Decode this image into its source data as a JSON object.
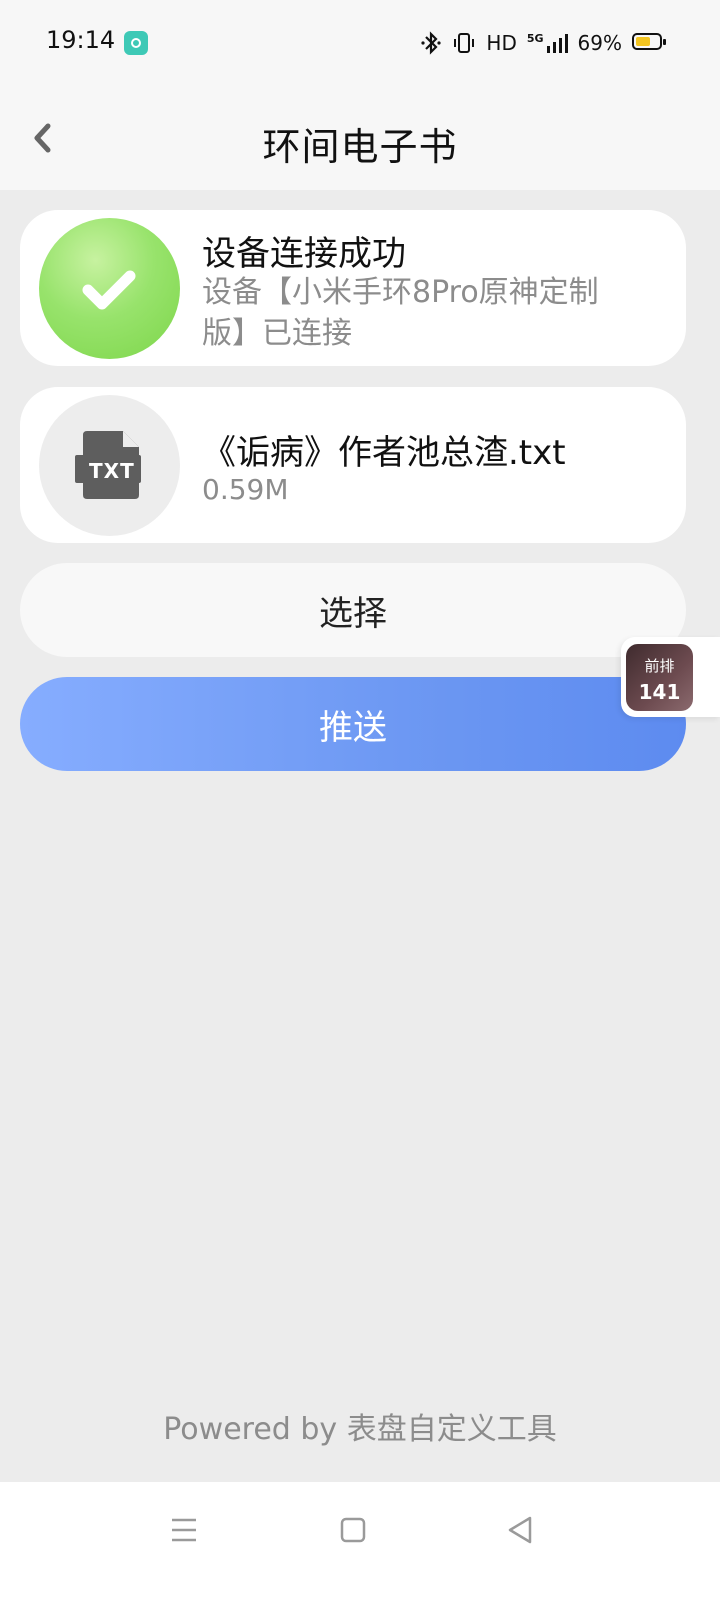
{
  "status": {
    "time": "19:14",
    "network": "HD",
    "signal": "5G",
    "battery_percent": "69%",
    "battery_level": 0.69,
    "battery_color": "#f3c521"
  },
  "header": {
    "title": "环间电子书",
    "back_icon": "chevron-left-icon"
  },
  "device_card": {
    "title": "设备连接成功",
    "subtitle": "设备【小米手环8Pro原神定制版】已连接",
    "icon": "check-icon",
    "icon_color": "#7dd64a"
  },
  "file_card": {
    "name": "《诟病》作者池总渣.txt",
    "size": "0.59M",
    "icon": "txt-file-icon",
    "icon_label": "TXT"
  },
  "buttons": {
    "select_label": "选择",
    "push_label": "推送"
  },
  "float_badge": {
    "label": "前排",
    "count": "141"
  },
  "footer": {
    "powered_by": "Powered by 表盘自定义工具"
  },
  "nav": {
    "menu_icon": "menu-icon",
    "home_icon": "square-icon",
    "back_icon": "triangle-back-icon"
  },
  "colors": {
    "background": "#ececec",
    "accent": "#6e99f3",
    "success": "#7dd64a"
  }
}
